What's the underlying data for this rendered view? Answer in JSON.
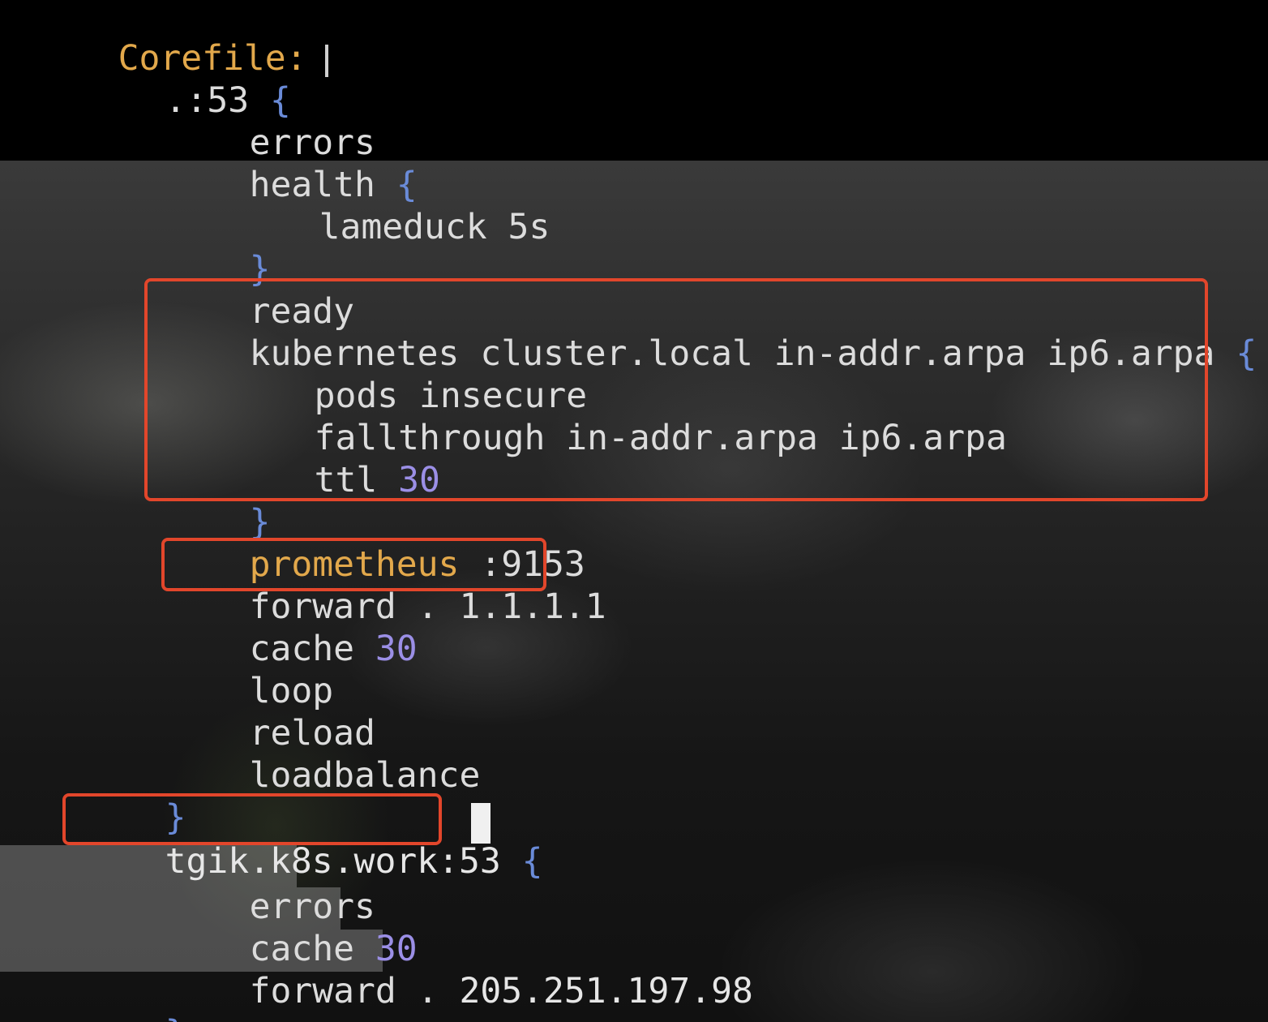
{
  "header": {
    "title": "Corefile:"
  },
  "lines": [
    {
      "indent": 1,
      "text": ".:53",
      "brace": "{"
    },
    {
      "indent": 2,
      "text": "errors"
    },
    {
      "indent": 2,
      "text": "health",
      "brace": "{"
    },
    {
      "indent": 3,
      "text": "lameduck 5s"
    },
    {
      "indent": 2,
      "brace": "}"
    },
    {
      "indent": 2,
      "text": "ready"
    },
    {
      "indent": 2,
      "text": "kubernetes cluster.local in-addr.arpa ip6.arpa",
      "brace": "{"
    },
    {
      "indent": 3,
      "text": "pods insecure"
    },
    {
      "indent": 3,
      "text": "fallthrough in-addr.arpa ip6.arpa"
    },
    {
      "indent": 3,
      "text": "ttl",
      "number": "30"
    },
    {
      "indent": 2,
      "brace": "}"
    },
    {
      "indent": 2,
      "text": "prometheus",
      "tail": ":9153"
    },
    {
      "indent": 2,
      "text": "forward . 1.1.1.1"
    },
    {
      "indent": 2,
      "text": "cache",
      "number": "30"
    },
    {
      "indent": 2,
      "text": "loop"
    },
    {
      "indent": 2,
      "text": "reload"
    },
    {
      "indent": 2,
      "text": "loadbalance"
    },
    {
      "indent": 1,
      "brace": "}"
    },
    {
      "indent": 1,
      "text": "tgik.k8s.work:53",
      "brace": "{"
    },
    {
      "indent": 2,
      "text": "errors"
    },
    {
      "indent": 2,
      "text": "cache",
      "number": "30"
    },
    {
      "indent": 2,
      "text": "forward .",
      "tail": "205.251.197.98"
    },
    {
      "indent": 1,
      "brace": "}"
    }
  ],
  "highlights": [
    {
      "name": "kubernetes-block-highlight"
    },
    {
      "name": "forward-line-highlight"
    },
    {
      "name": "tgik-zone-highlight"
    }
  ],
  "colors": {
    "key_orange": "#e2a84b",
    "brace_blue": "#6a8bd8",
    "number_purple": "#9b8fe6",
    "highlight_red": "#e2462b"
  }
}
